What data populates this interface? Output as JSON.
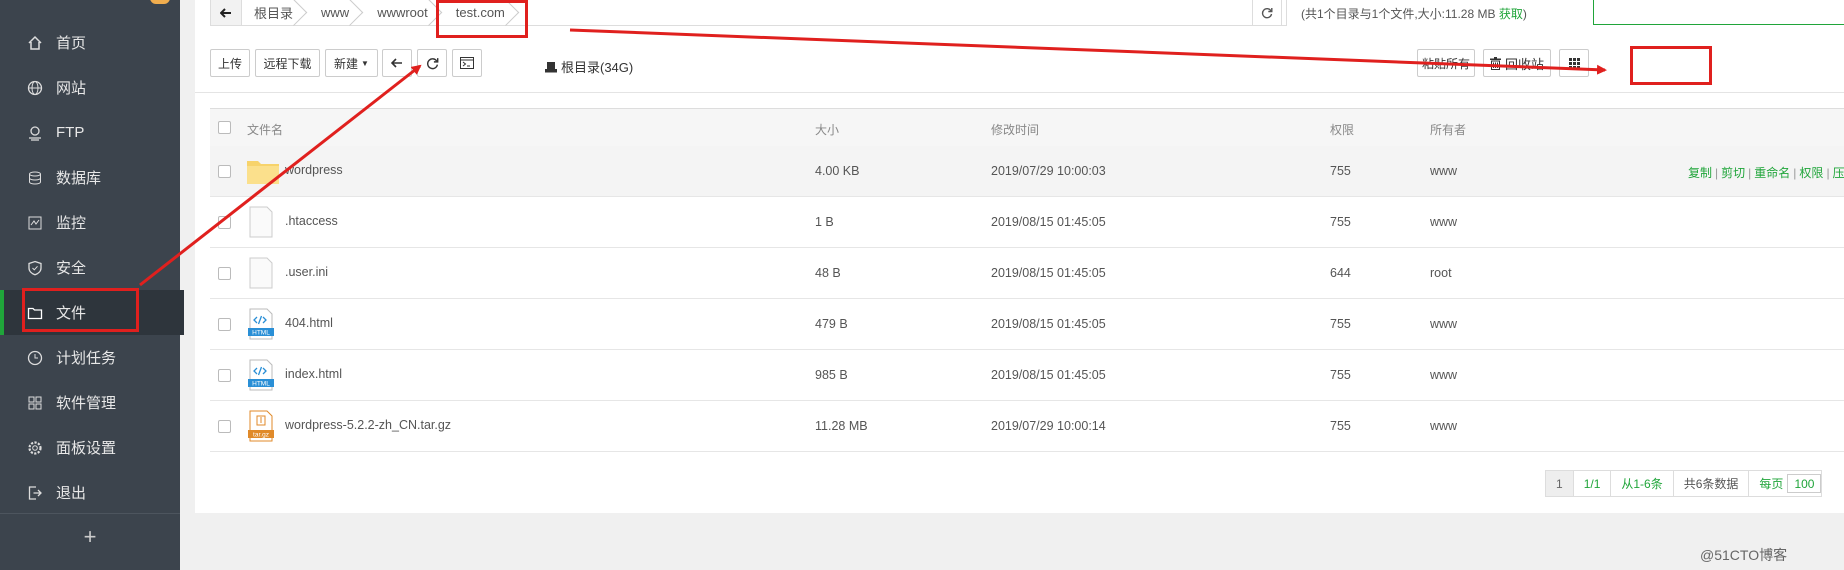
{
  "sidebar": {
    "items": [
      {
        "label": "首页",
        "icon": "home-icon"
      },
      {
        "label": "网站",
        "icon": "globe-icon"
      },
      {
        "label": "FTP",
        "icon": "ftp-icon"
      },
      {
        "label": "数据库",
        "icon": "database-icon"
      },
      {
        "label": "监控",
        "icon": "monitor-icon"
      },
      {
        "label": "安全",
        "icon": "shield-icon"
      },
      {
        "label": "文件",
        "icon": "folder-icon",
        "active": true
      },
      {
        "label": "计划任务",
        "icon": "clock-icon"
      },
      {
        "label": "软件管理",
        "icon": "grid-icon"
      },
      {
        "label": "面板设置",
        "icon": "gear-icon"
      },
      {
        "label": "退出",
        "icon": "logout-icon"
      }
    ],
    "add_label": "+"
  },
  "path": {
    "crumbs": [
      "根目录",
      "www",
      "wwwroot",
      "test.com"
    ]
  },
  "summary": {
    "text": "(共1个目录与1个文件,大小:11.28 MB ",
    "link": "获取",
    "close": ")"
  },
  "toolbar": {
    "upload": "上传",
    "remote_download": "远程下载",
    "new": "新建",
    "disk": "根目录(34G)",
    "paste_all": "粘贴所有",
    "recycle": "回收站"
  },
  "table": {
    "headers": {
      "name": "文件名",
      "size": "大小",
      "mtime": "修改时间",
      "perm": "权限",
      "owner": "所有者"
    },
    "rows": [
      {
        "name": "wordpress",
        "size": "4.00 KB",
        "mtime": "2019/07/29 10:00:03",
        "perm": "755",
        "owner": "www",
        "type": "folder"
      },
      {
        "name": ".htaccess",
        "size": "1 B",
        "mtime": "2019/08/15 01:45:05",
        "perm": "755",
        "owner": "www",
        "type": "file"
      },
      {
        "name": ".user.ini",
        "size": "48 B",
        "mtime": "2019/08/15 01:45:05",
        "perm": "644",
        "owner": "root",
        "type": "file"
      },
      {
        "name": "404.html",
        "size": "479 B",
        "mtime": "2019/08/15 01:45:05",
        "perm": "755",
        "owner": "www",
        "type": "html"
      },
      {
        "name": "index.html",
        "size": "985 B",
        "mtime": "2019/08/15 01:45:05",
        "perm": "755",
        "owner": "www",
        "type": "html"
      },
      {
        "name": "wordpress-5.2.2-zh_CN.tar.gz",
        "size": "11.28 MB",
        "mtime": "2019/07/29 10:00:14",
        "perm": "755",
        "owner": "www",
        "type": "archive"
      }
    ],
    "row_ops": [
      "复制",
      "剪切",
      "重命名",
      "权限",
      "压缩"
    ]
  },
  "pager": {
    "page": "1",
    "pages": "1/1",
    "range": "从1-6条",
    "total": "共6条数据",
    "per_page_label": "每页",
    "per_page": "100"
  },
  "icon_labels": {
    "html": "HTML",
    "archive": "tar.gz"
  },
  "watermark": "@51CTO博客",
  "colors": {
    "sidebar_bg": "#3c444d",
    "accent": "#20a53a",
    "annotation": "#e0201e"
  }
}
